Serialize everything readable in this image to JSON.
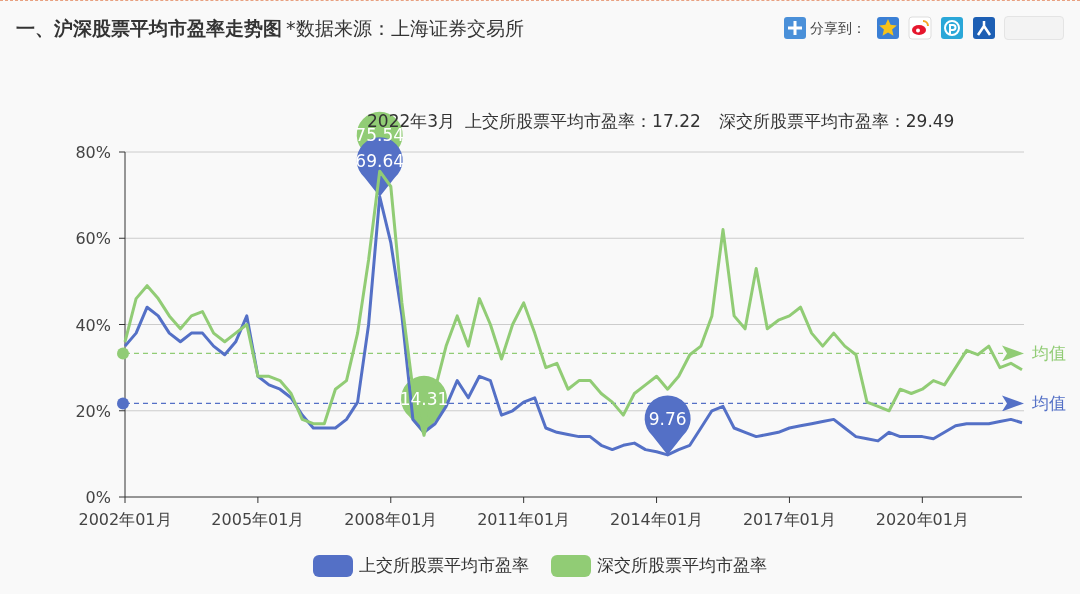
{
  "header": {
    "title": "一、沪深股票平均市盈率走势图",
    "source": "*数据来源：上海证券交易所",
    "share_label": "分享到："
  },
  "readout": [
    "2022年3月",
    "上交所股票平均市盈率：17.22",
    "深交所股票平均市盈率：29.49"
  ],
  "chart_data": {
    "type": "line",
    "ylim": [
      0,
      80
    ],
    "grid": true,
    "ref_lines": [
      {
        "axis": "y",
        "value": 33.3,
        "label": "均值",
        "color": "#91cc75"
      },
      {
        "axis": "y",
        "value": 21.7,
        "label": "均值",
        "color": "#5470c6"
      }
    ],
    "categories": [
      "2002年01月",
      null,
      null,
      null,
      null,
      null,
      null,
      null,
      null,
      null,
      null,
      null,
      "2005年01月",
      null,
      null,
      null,
      null,
      null,
      null,
      null,
      null,
      null,
      null,
      null,
      "2008年01月",
      null,
      null,
      null,
      null,
      null,
      null,
      null,
      null,
      null,
      null,
      null,
      "2011年01月",
      null,
      null,
      null,
      null,
      null,
      null,
      null,
      null,
      null,
      null,
      null,
      "2014年01月",
      null,
      null,
      null,
      null,
      null,
      null,
      null,
      null,
      null,
      null,
      null,
      "2017年01月",
      null,
      null,
      null,
      null,
      null,
      null,
      null,
      null,
      null,
      null,
      null,
      "2020年01月",
      null,
      null,
      null,
      null,
      null,
      null,
      null,
      null,
      null
    ],
    "yticks": [
      {
        "value": 0,
        "label": "0%"
      },
      {
        "value": 20,
        "label": "20%"
      },
      {
        "value": 40,
        "label": "40%"
      },
      {
        "value": 60,
        "label": "60%"
      },
      {
        "value": 80,
        "label": "80%"
      }
    ],
    "series": [
      {
        "name": "上交所股票平均市盈率",
        "color": "#5470c6",
        "values": [
          35,
          38,
          44,
          42,
          38,
          36,
          38,
          38,
          35,
          33,
          36,
          42,
          28,
          26,
          25,
          23,
          19,
          16,
          16,
          16,
          18,
          22,
          40,
          69.64,
          59,
          42,
          18,
          15,
          17,
          21,
          27,
          23,
          28,
          27,
          19,
          20,
          22,
          23,
          16,
          15,
          14.5,
          14,
          14,
          12,
          11,
          12,
          12.5,
          11,
          10.5,
          9.76,
          11,
          12,
          16,
          20,
          21,
          16,
          15,
          14,
          14.5,
          15,
          16,
          16.5,
          17,
          17.5,
          18,
          16,
          14,
          13.5,
          13,
          15,
          14,
          14,
          14,
          13.5,
          15,
          16.5,
          17,
          17,
          17,
          17.5,
          18,
          17.22
        ]
      },
      {
        "name": "深交所股票平均市盈率",
        "color": "#91cc75",
        "values": [
          36,
          46,
          49,
          46,
          42,
          39,
          42,
          43,
          38,
          36,
          38,
          40,
          28,
          28,
          27,
          24,
          18,
          17,
          17,
          25,
          27,
          38,
          55,
          75.54,
          72,
          45,
          25,
          14.31,
          25,
          35,
          42,
          35,
          46,
          40,
          32,
          40,
          45,
          38,
          30,
          31,
          25,
          27,
          27,
          24,
          22,
          19,
          24,
          26,
          28,
          25,
          28,
          33,
          35,
          42,
          62,
          42,
          39,
          53,
          39,
          41,
          42,
          44,
          38,
          35,
          38,
          35,
          33,
          22,
          21,
          20,
          25,
          24,
          25,
          27,
          26,
          30,
          34,
          33,
          35,
          30,
          31,
          29.49
        ]
      }
    ]
  },
  "markers": [
    {
      "kind": "max",
      "label": "75.54",
      "color": "#91cc75"
    },
    {
      "kind": "max",
      "label": "69.64",
      "color": "#5470c6"
    },
    {
      "kind": "min",
      "label": "14.31",
      "color": "#91cc75"
    },
    {
      "kind": "min",
      "label": "9.76",
      "color": "#5470c6"
    }
  ]
}
